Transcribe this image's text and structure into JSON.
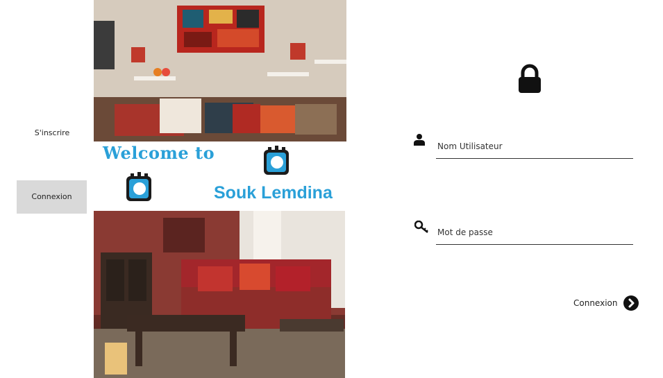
{
  "nav": {
    "signup_label": "S'inscrire",
    "login_label": "Connexion"
  },
  "banner": {
    "welcome": "Welcome to",
    "brand": "Souk Lemdina",
    "logo_text": "Souk Lemdina"
  },
  "login": {
    "username_placeholder": "Nom Utilisateur",
    "password_placeholder": "Mot de passe",
    "submit_label": "Connexion"
  },
  "colors": {
    "brand": "#2aa0d8",
    "nav_active_bg": "#d9d9d9"
  },
  "icons": {
    "lock": "lock-icon",
    "user": "user-icon",
    "key": "key-icon",
    "submit": "chevron-right-circle-icon"
  }
}
